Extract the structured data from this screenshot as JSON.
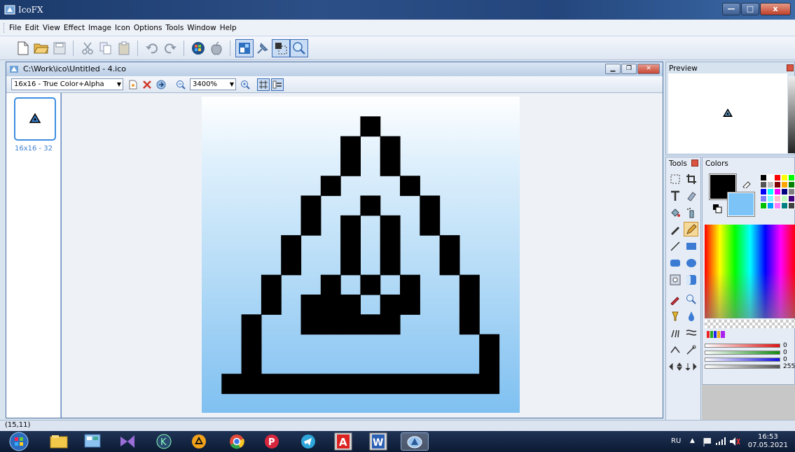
{
  "app": {
    "title": "IcoFX",
    "window_buttons": {
      "minimize": "—",
      "maximize": "□",
      "close": "x"
    }
  },
  "menu": [
    "File",
    "Edit",
    "View",
    "Effect",
    "Image",
    "Icon",
    "Options",
    "Tools",
    "Window",
    "Help"
  ],
  "toolbar_icons": [
    "new-file-icon",
    "open-folder-icon",
    "save-icon",
    "cut-icon",
    "copy-icon",
    "paste-icon",
    "undo-icon",
    "redo-icon",
    "windows-icon",
    "apple-icon",
    "image-editor-icon",
    "pin-icon",
    "selection-icon",
    "zoom-icon"
  ],
  "document": {
    "title": "C:\\Work\\ico\\Untitled - 4.ico",
    "format": "16x16 - True Color+Alpha",
    "zoom": "3400%",
    "thumbnail_label": "16x16 - 32"
  },
  "icon_pixels": [
    "................",
    "........#.......",
    ".......#.#......",
    ".......#.#......",
    "......#...#.....",
    ".....#..#..#....",
    ".....#.#.#.#....",
    "....#..#.#..#...",
    "....#..#.#..#...",
    "...#..#.#.#..#..",
    "...#.###.##..#..",
    "..#..#####...#..",
    "..#...........#.",
    "..#...........#.",
    ".##############.",
    "................"
  ],
  "panels": {
    "preview": "Preview",
    "tools": "Tools",
    "colors": "Colors"
  },
  "colors": {
    "primary": "#000000",
    "secondary": "#7cc4f8",
    "palette": [
      "#000000",
      "#ffffff",
      "#ff0000",
      "#ffff00",
      "#00ff00",
      "#555555",
      "#c0c0c0",
      "#800000",
      "#ffa500",
      "#008000",
      "#0000ff",
      "#00ffff",
      "#ff00ff",
      "#000080",
      "#808080",
      "#8080ff",
      "#80ffff",
      "#ffc0cb",
      "#c0ffc0",
      "#400080",
      "#00c000",
      "#00a0ff",
      "#ff80ff",
      "#008080",
      "#404040"
    ],
    "sliders": [
      {
        "color": "#e01010",
        "value": "0"
      },
      {
        "color": "#108a10",
        "value": "0"
      },
      {
        "color": "#1010e0",
        "value": "0"
      },
      {
        "color": "#888888",
        "value": "255"
      }
    ]
  },
  "status": {
    "coords": "(15,11)"
  },
  "taskbar": {
    "language": "RU",
    "time": "16:53",
    "date": "07.05.2021"
  }
}
